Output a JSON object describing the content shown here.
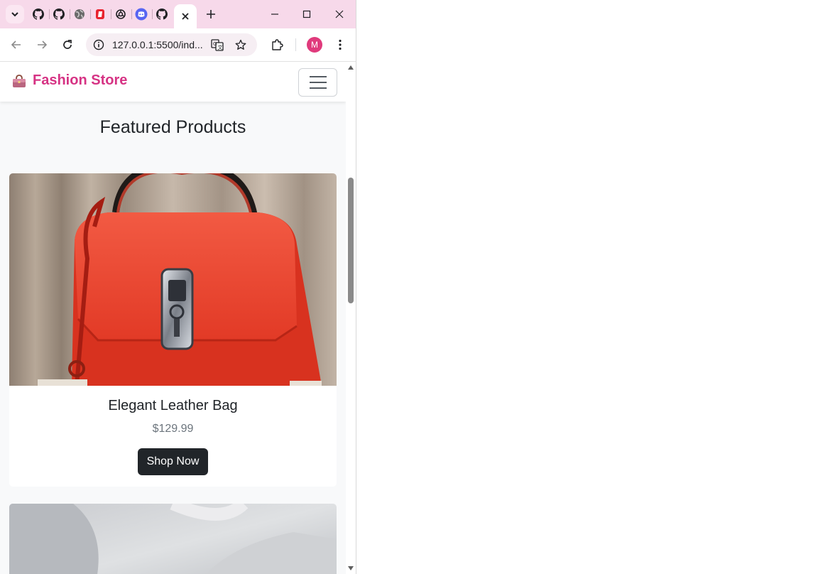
{
  "browser": {
    "tabs": [
      {
        "icon": "github-icon"
      },
      {
        "icon": "github-icon"
      },
      {
        "icon": "globe-icon"
      },
      {
        "icon": "red-app-icon"
      },
      {
        "icon": "openai-icon"
      },
      {
        "icon": "discord-icon"
      },
      {
        "icon": "github-icon"
      },
      {
        "icon": "close-icon",
        "active": true
      }
    ],
    "url": "127.0.0.1:5500/ind...",
    "profile_initial": "M"
  },
  "page": {
    "brand": "Fashion Store",
    "section_title": "Featured Products",
    "products": [
      {
        "title": "Elegant Leather Bag",
        "price": "$129.99",
        "button": "Shop Now"
      }
    ]
  },
  "colors": {
    "brand": "#d63384",
    "button": "#212529",
    "tabstrip": "#f7d9ea",
    "avatar": "#e03a7c"
  }
}
